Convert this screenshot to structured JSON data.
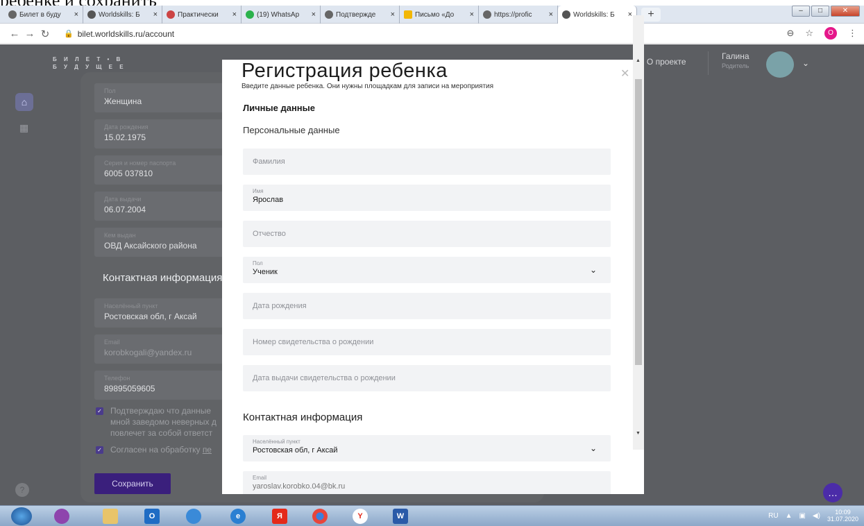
{
  "caption_top": "ребенке и сохранить",
  "browser": {
    "tabs": [
      {
        "label": "Билет в буду",
        "icon": "globe-icon",
        "active": false
      },
      {
        "label": "Worldskills: Б",
        "icon": "worldskills-icon",
        "active": false
      },
      {
        "label": "Практически",
        "icon": "ppt-icon",
        "active": false
      },
      {
        "label": "(19) WhatsAp",
        "icon": "whatsapp-icon",
        "active": false
      },
      {
        "label": "Подтвержде",
        "icon": "globe-icon",
        "active": false
      },
      {
        "label": "Письмо «До",
        "icon": "mail-icon",
        "active": false
      },
      {
        "label": "https://profic",
        "icon": "globe-icon",
        "active": false
      },
      {
        "label": "Worldskills: Б",
        "icon": "worldskills-icon",
        "active": true
      }
    ],
    "tab_close": "×",
    "newtab": "+",
    "url": "bilet.worldskills.ru/account",
    "profile_letter": "O"
  },
  "site": {
    "brand_line1": "Б И Л Е Т • В",
    "brand_line2": "Б У Д У Щ Е Е",
    "nav_about": "О проекте",
    "user_name": "Галина",
    "user_role": "Родитель",
    "save_button": "Сохранить"
  },
  "background_form": {
    "fields": [
      {
        "label": "Пол",
        "value": "Женщина"
      },
      {
        "label": "Дата рождения",
        "value": "15.02.1975"
      },
      {
        "label": "Серия и номер паспорта",
        "value": "6005 037810"
      },
      {
        "label": "Дата выдачи",
        "value": "06.07.2004"
      },
      {
        "label": "Кем выдан",
        "value": "ОВД Аксайского района"
      }
    ],
    "contact_heading": "Контактная информация",
    "contact_fields": [
      {
        "label": "Населённый пункт",
        "value": "Ростовская обл, г Аксай"
      },
      {
        "label": "Email",
        "value": "korobkogali@yandex.ru"
      },
      {
        "label": "Телефон",
        "value": "89895059605"
      }
    ],
    "check1": "Подтверждаю что данные",
    "check1b": "мной заведомо неверных д",
    "check1c": "повлечет за собой ответст",
    "check2": "Согласен на обработку",
    "check2_link": "пе"
  },
  "modal": {
    "title": "Регистрация ребенка",
    "subtitle": "Введите данные ребенка. Они нужны площадкам для записи на мероприятия",
    "section_personal": "Личные данные",
    "section_personal_data": "Персональные данные",
    "surname_placeholder": "Фамилия",
    "name_label": "Имя",
    "name_value": "Ярослав",
    "patronymic_placeholder": "Отчество",
    "gender_label": "Пол",
    "gender_value": "Ученик",
    "birthdate_placeholder": "Дата рождения",
    "certificate_placeholder": "Номер свидетельства о рождении",
    "certificate_date_placeholder": "Дата выдачи свидетельства о рождении",
    "section_contact": "Контактная информация",
    "city_label": "Населённый пункт",
    "city_value": "Ростовская обл, г Аксай",
    "email_label": "Email",
    "email_value": "yaroslav.korobko.04@bk.ru"
  },
  "taskbar": {
    "lang": "RU",
    "time": "10:09",
    "date": "31.07.2020"
  }
}
